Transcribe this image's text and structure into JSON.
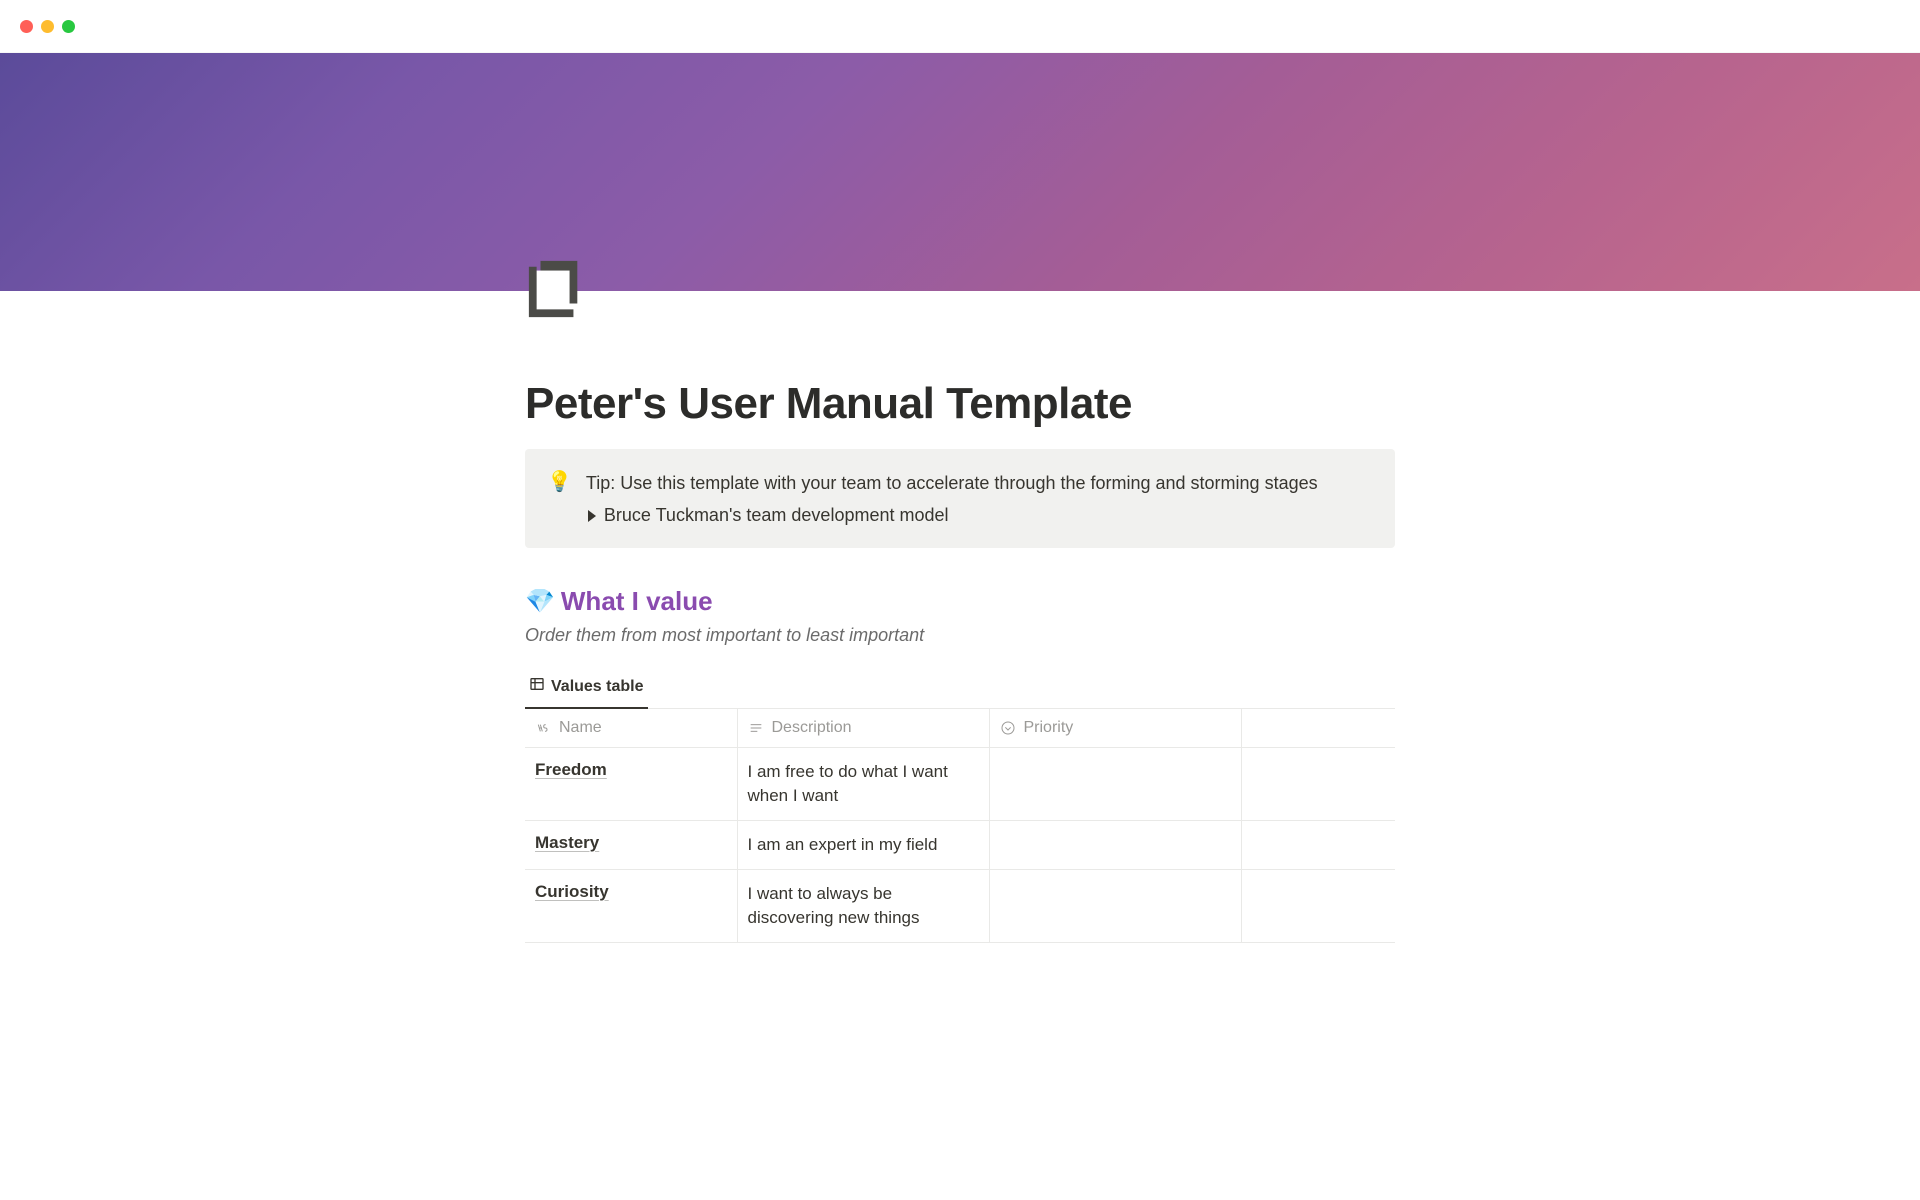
{
  "page": {
    "title": "Peter's User Manual Template"
  },
  "callout": {
    "icon": "💡",
    "text": "Tip: Use this template with your team to accelerate through the forming and storming stages",
    "toggle_label": "Bruce Tuckman's team development model"
  },
  "section_values": {
    "emoji": "💎",
    "title": "What I value",
    "subtitle": "Order them from most important to least important",
    "view_tab": "Values table",
    "columns": {
      "name": "Name",
      "description": "Description",
      "priority": "Priority"
    },
    "rows": [
      {
        "name": "Freedom",
        "description": "I am free to do what I want when I want",
        "priority": ""
      },
      {
        "name": "Mastery",
        "description": "I am an expert in my field",
        "priority": ""
      },
      {
        "name": "Curiosity",
        "description": "I want to always be discovering new things",
        "priority": ""
      }
    ]
  }
}
